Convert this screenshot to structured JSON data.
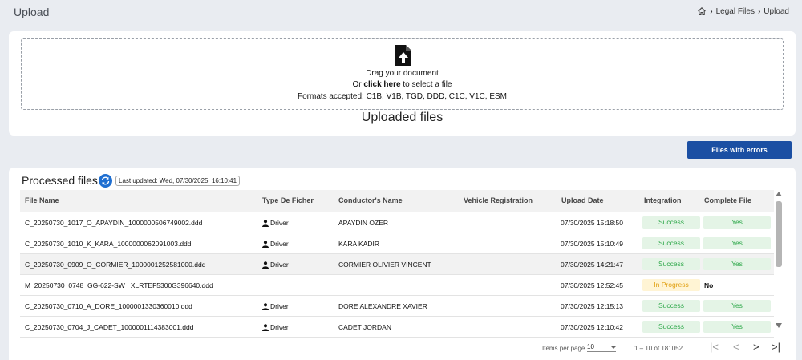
{
  "page": {
    "title": "Upload",
    "breadcrumb": [
      "Legal Files",
      "Upload"
    ]
  },
  "upload": {
    "drag_text": "Drag your document",
    "or_prefix": "Or",
    "click_here": "click here",
    "select_suffix": "to select a file",
    "formats": "Formats accepted: C1B, V1B, TGD, DDD, C1C, V1C, ESM",
    "uploaded_title": "Uploaded files"
  },
  "errors_button": "Files with errors",
  "processed": {
    "title": "Processed files",
    "last_updated": "Last updated: Wed, 07/30/2025, 16:10:41",
    "columns": [
      "File Name",
      "Type De Ficher",
      "Conductor's Name",
      "Vehicle Registration",
      "Upload Date",
      "Integration",
      "Complete File"
    ],
    "rows": [
      {
        "file": "C_20250730_1017_O_APAYDIN_1000000506749002.ddd",
        "type": "Driver",
        "conductor": "APAYDIN OZER",
        "vehicle": "",
        "date": "07/30/2025 15:18:50",
        "integration": "Success",
        "complete": "Yes"
      },
      {
        "file": "C_20250730_1010_K_KARA_1000000062091003.ddd",
        "type": "Driver",
        "conductor": "KARA KADIR",
        "vehicle": "",
        "date": "07/30/2025 15:10:49",
        "integration": "Success",
        "complete": "Yes"
      },
      {
        "file": "C_20250730_0909_O_CORMIER_1000001252581000.ddd",
        "type": "Driver",
        "conductor": "CORMIER OLIVIER VINCENT",
        "vehicle": "",
        "date": "07/30/2025 14:21:47",
        "integration": "Success",
        "complete": "Yes"
      },
      {
        "file": "M_20250730_0748_GG-622-SW _XLRTEF5300G396640.ddd",
        "type": "",
        "conductor": "",
        "vehicle": "",
        "date": "07/30/2025 12:52:45",
        "integration": "In Progress",
        "complete": "No"
      },
      {
        "file": "C_20250730_0710_A_DORE_1000001330360010.ddd",
        "type": "Driver",
        "conductor": "DORE ALEXANDRE XAVIER",
        "vehicle": "",
        "date": "07/30/2025 12:15:13",
        "integration": "Success",
        "complete": "Yes"
      },
      {
        "file": "C_20250730_0704_J_CADET_1000001114383001.ddd",
        "type": "Driver",
        "conductor": "CADET JORDAN",
        "vehicle": "",
        "date": "07/30/2025 12:10:42",
        "integration": "Success",
        "complete": "Yes"
      }
    ]
  },
  "paginator": {
    "items_per_page_label": "Items per page",
    "items_per_page": "10",
    "range": "1 – 10 of 181052",
    "first_icon": "|<",
    "prev_icon": "<",
    "next_icon": ">",
    "last_icon": ">|"
  },
  "colors": {
    "primary_button": "#1b4fa3",
    "success": "#2ea84a",
    "in_progress": "#e1a012",
    "refresh_icon": "#1f6fd1"
  }
}
